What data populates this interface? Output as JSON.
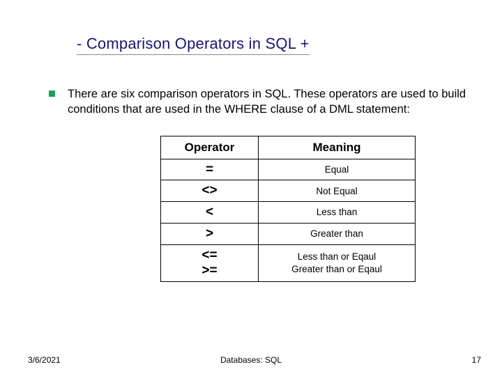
{
  "title": "- Comparison Operators in SQL +",
  "paragraph": "There are six comparison operators in SQL. These operators are used to build conditions  that are used in the WHERE clause of a DML statement:",
  "table": {
    "headers": {
      "operator": "Operator",
      "meaning": "Meaning"
    },
    "rows": [
      {
        "operator": "=",
        "meaning": "Equal"
      },
      {
        "operator": "<>",
        "meaning": "Not Equal"
      },
      {
        "operator": "<",
        "meaning": "Less than"
      },
      {
        "operator": ">",
        "meaning": "Greater than"
      },
      {
        "operator": "<=\n>=",
        "meaning": "Less  than or Eqaul\nGreater  than or Eqaul"
      }
    ]
  },
  "footer": {
    "date": "3/6/2021",
    "center": "Databases: SQL",
    "page": "17"
  }
}
